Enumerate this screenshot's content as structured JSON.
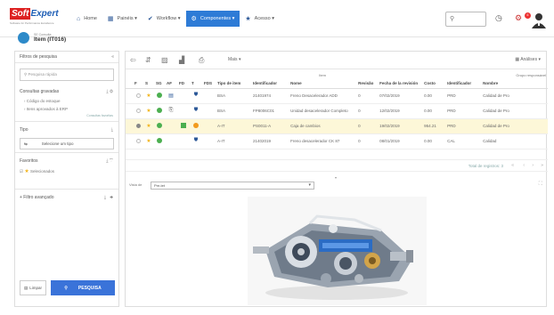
{
  "logo": {
    "brand_a": "Soft",
    "brand_b": "Expert",
    "tagline": "Software for Performance Excellence"
  },
  "nav": [
    {
      "icon": "home-icon",
      "glyph": "⌂",
      "label": "Home"
    },
    {
      "icon": "grid-icon",
      "glyph": "▦",
      "label": "Painéis ▾"
    },
    {
      "icon": "check-icon",
      "glyph": "✔",
      "label": "Workflow ▾"
    },
    {
      "icon": "component-icon",
      "glyph": "⚙",
      "label": "Componentes ▾"
    },
    {
      "icon": "star-icon",
      "glyph": "★",
      "label": "Acesso ▾"
    }
  ],
  "search": {
    "placeholder": ""
  },
  "header": {
    "notifications": "6"
  },
  "breadcrumb": {
    "sub": "SE Consulta",
    "title": "Item (IT016)"
  },
  "filter_panel": {
    "title": "Filtros de pesquisa",
    "collapse": "«",
    "search_placeholder": "Pesquisa rápida",
    "saved_queries": "Consultas gravadas",
    "saved_items": [
      "Código do estoque",
      "Itens aprovados à ERP"
    ],
    "more_link": "Consultas favoritas",
    "type_label": "Tipo",
    "type_button": "Selecione um tipo",
    "favorites_label": "Favoritos",
    "favorites_item": "Selecionados",
    "advanced_label": "+ Filtro avançado",
    "clear_button": "Limpar",
    "search_button": "PESQUISA"
  },
  "toolbar": {
    "more": "Mais ▾",
    "analysis": "Análises ▾"
  },
  "table": {
    "group_headers": {
      "item": "Item",
      "responsible": "Grupo responsável"
    },
    "headers": [
      "F",
      "S",
      "SG",
      "AF",
      "FD",
      "T",
      "FDS",
      "Tipo de item",
      "Identificador",
      "Nome",
      "Revisão",
      "Fecha de la revisión",
      "Costo",
      "Identificador",
      "Nombre"
    ],
    "rows": [
      {
        "selected": false,
        "radio": false,
        "sg": "#4caf50",
        "af": "doc",
        "fd": "",
        "type": "BSA",
        "id": "21401974",
        "name": "Freno Desacelerador ADD",
        "rev": "0",
        "date": "07/02/2019",
        "cost": "0.00",
        "gid": "PRD",
        "gname": "Calidad de Pro"
      },
      {
        "selected": false,
        "radio": false,
        "sg": "#4caf50",
        "af": "doc",
        "fd": "",
        "type": "BSA",
        "id": "FP8006C01",
        "name": "Unidad desacelerador Completo",
        "rev": "0",
        "date": "12/02/2019",
        "cost": "0.00",
        "gid": "PRD",
        "gname": "Calidad de Pro"
      },
      {
        "selected": true,
        "radio": true,
        "sg": "#4caf50",
        "af": "green",
        "fd": "#f2b51d",
        "type": "A-IT",
        "id": "PS0011-A",
        "name": "Caja de cambios",
        "rev": "0",
        "date": "19/02/2019",
        "cost": "954.21",
        "gid": "PRD",
        "gname": "Calidad de Pro"
      },
      {
        "selected": false,
        "radio": false,
        "sg": "#4caf50",
        "af": "",
        "fd": "",
        "type": "A-IT",
        "id": "21402019",
        "name": "Freno desacelerador CK 87",
        "rev": "0",
        "date": "08/01/2019",
        "cost": "0.00",
        "gid": "CAL",
        "gname": "Calidad"
      }
    ]
  },
  "pager": {
    "total": "Total de registros: 3"
  },
  "preview": {
    "label": "Vista de",
    "select_value": "Pre-tet"
  }
}
